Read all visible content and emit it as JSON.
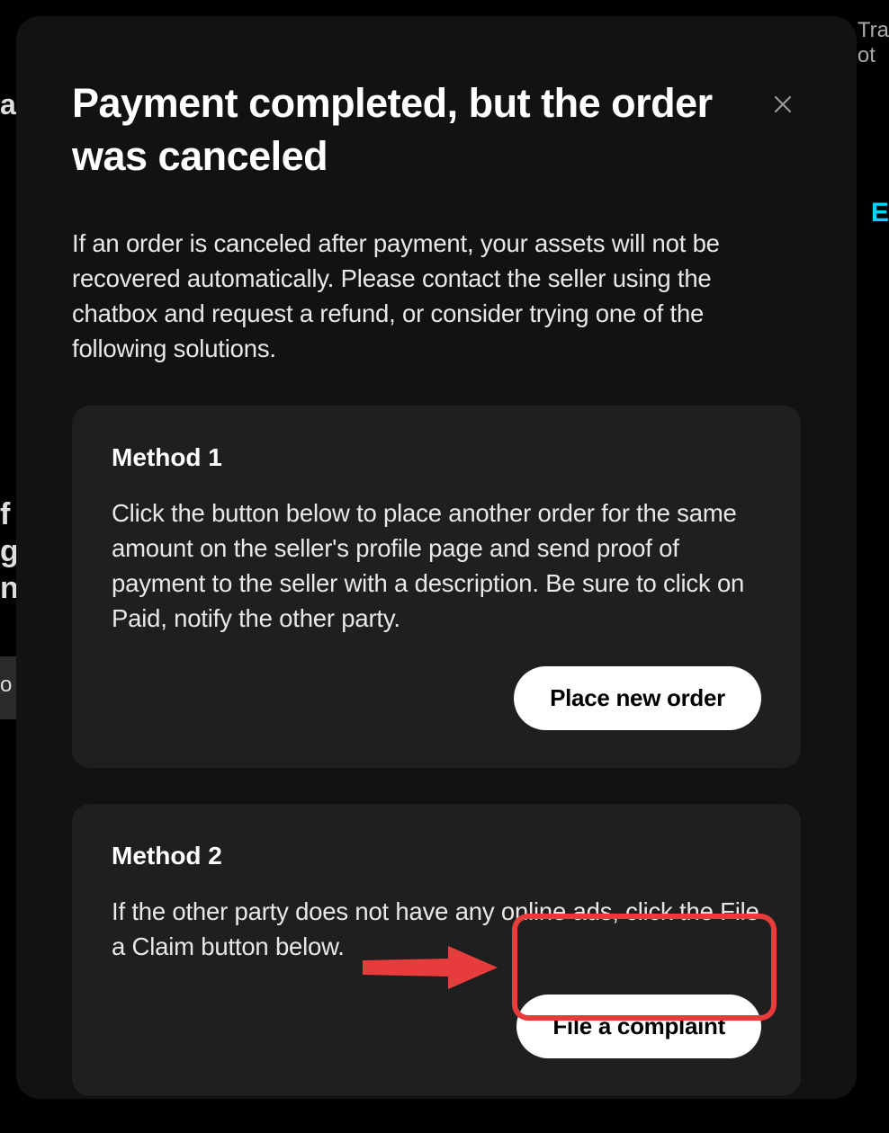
{
  "background": {
    "top_right_1": "Tra",
    "top_right_2": "ot",
    "left_char": "a",
    "right_char": "E",
    "left_mid_1": "f",
    "left_mid_2": "g",
    "left_mid_3": "n",
    "tab_char": "o"
  },
  "modal": {
    "title": "Payment completed, but the order was canceled",
    "description": "If an order is canceled after payment, your assets will not be recovered automatically. Please contact the seller using the chatbox and request a refund, or consider trying one of the following solutions.",
    "methods": [
      {
        "title": "Method 1",
        "description": "Click the button below to place another order for the same amount on the seller's profile page and send proof of payment to the seller with a description. Be sure to click on Paid, notify the other party.",
        "button_label": "Place new order"
      },
      {
        "title": "Method 2",
        "description": "If the other party does not have any online ads, click the File a Claim button below.",
        "button_label": "File a complaint"
      }
    ]
  },
  "annotation": {
    "highlight_color": "#e73c3c"
  }
}
